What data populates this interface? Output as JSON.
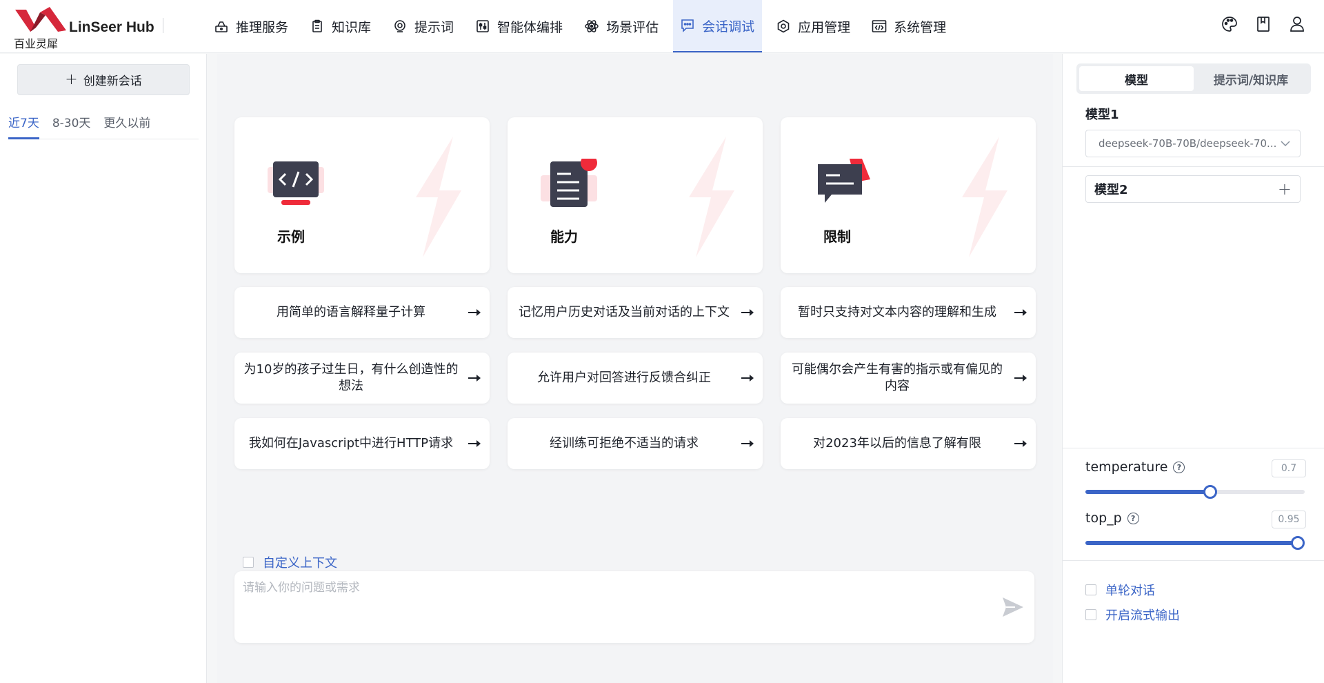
{
  "header": {
    "brand_name": "LinSeer Hub",
    "brand_sub": "百业灵犀",
    "nav": [
      {
        "label": "推理服务",
        "icon": "inference-icon"
      },
      {
        "label": "知识库",
        "icon": "clipboard-icon"
      },
      {
        "label": "提示词",
        "icon": "prompt-icon"
      },
      {
        "label": "智能体编排",
        "icon": "sliders-icon"
      },
      {
        "label": "场景评估",
        "icon": "atom-icon"
      },
      {
        "label": "会话调试",
        "icon": "chat-icon",
        "active": true
      },
      {
        "label": "应用管理",
        "icon": "hexagon-gear-icon"
      },
      {
        "label": "系统管理",
        "icon": "code-window-icon"
      }
    ],
    "right_icons": [
      "palette-icon",
      "book-icon",
      "user-icon"
    ]
  },
  "sidebar": {
    "new_chat_label": "创建新会话",
    "time_tabs": [
      "近7天",
      "8-30天",
      "更久以前"
    ],
    "active_tab": "近7天"
  },
  "main": {
    "features": [
      {
        "title": "示例",
        "icon": "code-monitor-icon"
      },
      {
        "title": "能力",
        "icon": "document-icon"
      },
      {
        "title": "限制",
        "icon": "message-icon"
      }
    ],
    "prompts": [
      [
        "用简单的语言解释量子计算",
        "记忆用户历史对话及当前对话的上下文",
        "暂时只支持对文本内容的理解和生成"
      ],
      [
        "为10岁的孩子过生日，有什么创造性的想法",
        "允许用户对回答进行反馈合纠正",
        "可能偶尔会产生有害的指示或有偏见的内容"
      ],
      [
        "我如何在Javascript中进行HTTP请求",
        "经训练可拒绝不适当的请求",
        "对2023年以后的信息了解有限"
      ]
    ],
    "custom_context_label": "自定义上下文",
    "input_placeholder": "请输入你的问题或需求"
  },
  "right_panel": {
    "tabs": [
      "模型",
      "提示词/知识库"
    ],
    "active_tab": "模型",
    "model1_label": "模型1",
    "model1_value": "deepseek-70B-70B/deepseek-70...",
    "model2_label": "模型2",
    "params": [
      {
        "name": "temperature",
        "value": "0.7",
        "fraction": 0.57
      },
      {
        "name": "top_p",
        "value": "0.95",
        "fraction": 0.97
      }
    ],
    "options": [
      {
        "label": "单轮对话",
        "checked": false
      },
      {
        "label": "开启流式输出",
        "checked": false
      }
    ]
  },
  "colors": {
    "accent": "#3b65c7",
    "brand_red": "#d6283b",
    "active_nav_bg": "#e8eefb"
  }
}
